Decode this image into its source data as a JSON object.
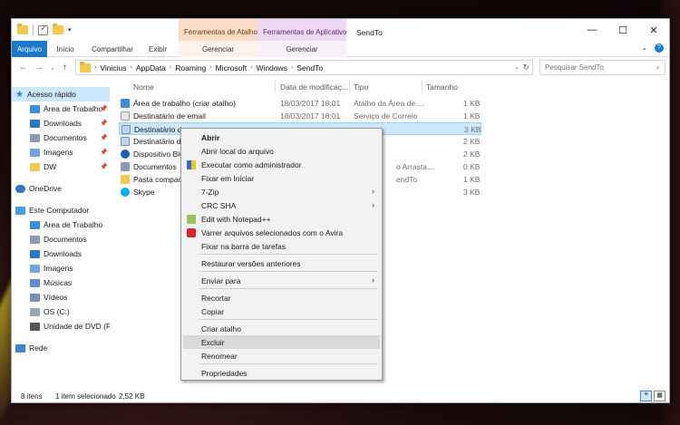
{
  "window": {
    "title": "SendTo",
    "contextual_tabs": [
      "Ferramentas de Atalho",
      "Ferramentas de Aplicativo"
    ]
  },
  "ribbon": {
    "tabs": [
      "Arquivo",
      "Início",
      "Compartilhar",
      "Exibir",
      "Gerenciar",
      "Gerenciar"
    ]
  },
  "address": {
    "crumbs": [
      "Vinicius",
      "AppData",
      "Roaming",
      "Microsoft",
      "Windows",
      "SendTo"
    ],
    "search_placeholder": "Pesquisar SendTo"
  },
  "nav": {
    "items": [
      {
        "label": "Acesso rápido",
        "icon": "star-icon",
        "pinned": false
      },
      {
        "label": "Área de Trabalho",
        "icon": "desktop-icon",
        "pinned": true
      },
      {
        "label": "Downloads",
        "icon": "download-icon",
        "pinned": true
      },
      {
        "label": "Documentos",
        "icon": "documents-icon",
        "pinned": true
      },
      {
        "label": "Imagens",
        "icon": "pictures-icon",
        "pinned": true
      },
      {
        "label": "DW",
        "icon": "folder-icon",
        "pinned": true
      },
      {
        "label": "OneDrive",
        "icon": "cloud-icon",
        "pinned": false
      },
      {
        "label": "Este Computador",
        "icon": "computer-icon",
        "pinned": false
      },
      {
        "label": "Área de Trabalho",
        "icon": "desktop-icon",
        "pinned": false
      },
      {
        "label": "Documentos",
        "icon": "documents-icon",
        "pinned": false
      },
      {
        "label": "Downloads",
        "icon": "download-icon",
        "pinned": false
      },
      {
        "label": "Imagens",
        "icon": "pictures-icon",
        "pinned": false
      },
      {
        "label": "Músicas",
        "icon": "music-icon",
        "pinned": false
      },
      {
        "label": "Vídeos",
        "icon": "video-icon",
        "pinned": false
      },
      {
        "label": "OS (C:)",
        "icon": "drive-icon",
        "pinned": false
      },
      {
        "label": "Unidade de DVD (F:",
        "icon": "dvd-icon",
        "pinned": false
      },
      {
        "label": "Rede",
        "icon": "network-icon",
        "pinned": false
      }
    ]
  },
  "columns": [
    "Nome",
    "Data de modificaç...",
    "Tipo",
    "Tamanho"
  ],
  "files": [
    {
      "name": "Área de trabalho (criar atalho)",
      "date": "18/03/2017 18:01",
      "type": "Atalho da Área de ...",
      "size": "1 KB",
      "icon": "desktop-shortcut-icon"
    },
    {
      "name": "Destinatário de email",
      "date": "18/03/2017 18:01",
      "type": "Serviço de Correio",
      "size": "1 KB",
      "icon": "mail-icon"
    },
    {
      "name": "Destinatário de",
      "date": "",
      "type": "",
      "size": "3 KB",
      "icon": "shortcut-icon"
    },
    {
      "name": "Destinatário de",
      "date": "",
      "type": "",
      "size": "2 KB",
      "icon": "shortcut-icon"
    },
    {
      "name": "Dispositivo Blu",
      "date": "",
      "type": "",
      "size": "2 KB",
      "icon": "bluetooth-icon"
    },
    {
      "name": "Documentos",
      "date": "",
      "type": "o Arrasta...",
      "size": "0 KB",
      "icon": "documents-icon"
    },
    {
      "name": "Pasta compact",
      "date": "",
      "type": "endTo",
      "size": "1 KB",
      "icon": "zip-folder-icon"
    },
    {
      "name": "Skype",
      "date": "",
      "type": "",
      "size": "3 KB",
      "icon": "skype-icon"
    }
  ],
  "status": {
    "count": "8 itens",
    "selection": "1 item selecionado",
    "size": "2,52 KB"
  },
  "context_menu": {
    "items": [
      {
        "label": "Abrir",
        "bold": true,
        "icon": "",
        "submenu": false
      },
      {
        "label": "Abrir local do arquivo",
        "bold": false,
        "icon": "",
        "submenu": false
      },
      {
        "label": "Executar como administrador",
        "bold": false,
        "icon": "shield-icon",
        "submenu": false
      },
      {
        "label": "Fixar em Iniciar",
        "bold": false,
        "icon": "",
        "submenu": false
      },
      {
        "label": "7-Zip",
        "bold": false,
        "icon": "",
        "submenu": true
      },
      {
        "label": "CRC SHA",
        "bold": false,
        "icon": "",
        "submenu": true
      },
      {
        "label": "Edit with Notepad++",
        "bold": false,
        "icon": "notepad-icon",
        "submenu": false
      },
      {
        "label": "Varrer arquivos selecionados com o Avira",
        "bold": false,
        "icon": "avira-icon",
        "submenu": false
      },
      {
        "label": "Fixar na barra de tarefas",
        "bold": false,
        "icon": "",
        "submenu": false
      },
      {
        "label": "Restaurar versões anteriores",
        "bold": false,
        "icon": "",
        "submenu": false
      },
      {
        "label": "Enviar para",
        "bold": false,
        "icon": "",
        "submenu": true
      },
      {
        "label": "Recortar",
        "bold": false,
        "icon": "",
        "submenu": false
      },
      {
        "label": "Copiar",
        "bold": false,
        "icon": "",
        "submenu": false
      },
      {
        "label": "Criar atalho",
        "bold": false,
        "icon": "",
        "submenu": false
      },
      {
        "label": "Excluir",
        "bold": false,
        "icon": "",
        "submenu": false
      },
      {
        "label": "Renomear",
        "bold": false,
        "icon": "",
        "submenu": false
      },
      {
        "label": "Propriedades",
        "bold": false,
        "icon": "",
        "submenu": false
      }
    ],
    "highlighted": "Excluir"
  },
  "colors": {
    "accent": "#1979ca",
    "selection": "#cce8ff",
    "shortcut_tools": "#fbdcc7",
    "app_tools": "#eed9f5"
  }
}
